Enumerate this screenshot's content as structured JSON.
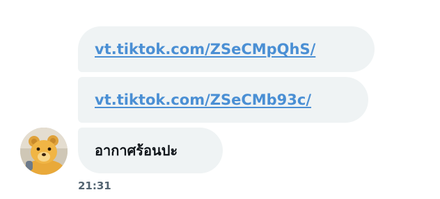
{
  "conversation": {
    "messages": [
      {
        "type": "link",
        "text": "vt.tiktok.com/ZSeCMpQhS/"
      },
      {
        "type": "link",
        "text": "vt.tiktok.com/ZSeCMb93c/"
      },
      {
        "type": "text",
        "text": "อากาศร้อนปะ"
      }
    ],
    "timestamp": "21:31",
    "avatar": {
      "icon": "teddy-bear-avatar-icon"
    }
  },
  "colors": {
    "bubble": "#eff3f4",
    "link": "#4a8fd4",
    "text": "#0f1419",
    "timestamp": "#536471"
  }
}
